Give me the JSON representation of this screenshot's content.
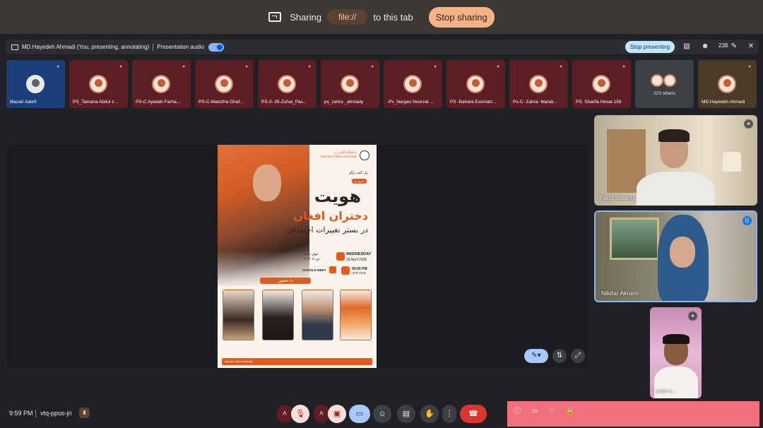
{
  "sharebar": {
    "sharing_label": "Sharing",
    "source": "file://",
    "to_tab": "to this tab",
    "stop_sharing": "Stop sharing"
  },
  "presenting": {
    "status": "MD.Hayedeh Ahmadi (You, presenting, annotating)",
    "audio_label": "Presentation audio",
    "stop_presenting": "Stop presenting",
    "participant_count": "238"
  },
  "tiles": [
    {
      "name": "Mazari Aatefi"
    },
    {
      "name": "PS_Tamana Abdul z..."
    },
    {
      "name": "PS-C Ayedah Farha..."
    },
    {
      "name": "PS-C-Manizha Ghaf..."
    },
    {
      "name": "PS-3- 35-Zuhal_Pas..."
    },
    {
      "name": "ps_zahra _ahmady"
    },
    {
      "name": "-Ps_Narges Noorzai ..."
    },
    {
      "name": "PS -Bahara Essmatz..."
    },
    {
      "name": "Ps-C- Zahra- Mandi..."
    },
    {
      "name": "PS. Sharifa Hesar.158"
    },
    {
      "name": "223 others"
    },
    {
      "name": "MD.Hayedeh Ahmadi"
    }
  ],
  "poster": {
    "uni_fa": "دانشگاه آنلاین زن",
    "uni_en": "Woman Online University",
    "small_fa": "پنل گفت وگو",
    "tag_fa": "سری نو",
    "title1": "هویت",
    "title2": "دختران افغان",
    "title3": "در بستر تغییرات اجتماعی",
    "day_fa": "چهار شنبه",
    "date_fa": "۹ ثور ۱۴۰۵",
    "weekday": "WEDNESDAY",
    "date_en": "29 April 2026",
    "platform": "GOOGLE MEET",
    "time": "09:00 PM",
    "tz": "AFG Time",
    "presence": "با حضور",
    "footer": "Woman Online University"
  },
  "videos": [
    {
      "name": "Farid Salangi"
    },
    {
      "name": "Nilofar Akrami"
    },
    {
      "name": "arish o..."
    }
  ],
  "bottom": {
    "time": "9:59 PM",
    "meeting_code": "vtq-ppus-jri"
  }
}
